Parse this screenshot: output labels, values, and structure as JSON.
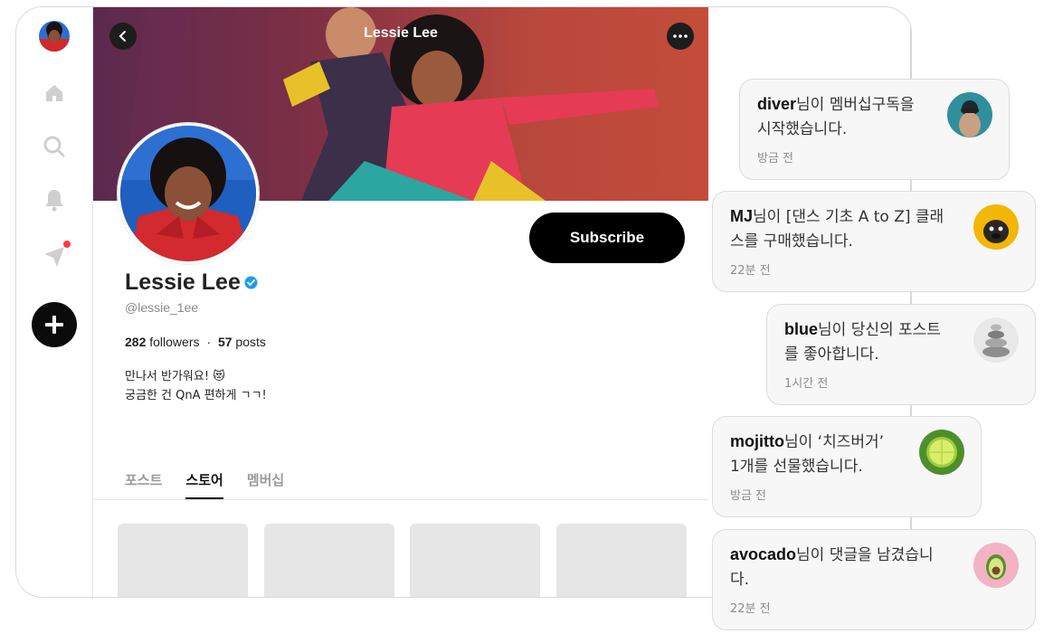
{
  "profile": {
    "cover_title": "Lessie Lee",
    "name": "Lessie Lee",
    "handle": "@lessie_1ee",
    "followers_count": "282",
    "followers_label": "followers",
    "separator": "·",
    "posts_count": "57",
    "posts_label": "posts",
    "bio_line1": "만나서 반가워요! 😻",
    "bio_line2": "궁금한 건 QnA 편하게 ㄱㄱ!",
    "subscribe_label": "Subscribe"
  },
  "tabs": [
    "포스트",
    "스토어",
    "멤버십"
  ],
  "active_tab": "스토어",
  "nav_icons": [
    "user-avatar",
    "home-icon",
    "search-icon",
    "bell-icon",
    "send-icon",
    "plus-icon"
  ],
  "notifications": [
    {
      "user": "diver",
      "text_line1": "님이 멤버십구독을",
      "text_line2": "시작했습니다.",
      "time": "방금 전",
      "avatar": "diver-avatar"
    },
    {
      "user": "MJ",
      "text_line1": "님이 [댄스 기초 A to Z] 클래",
      "text_line2": "스를 구매했습니다.",
      "time": "22분 전",
      "avatar": "dog-avatar"
    },
    {
      "user": "blue",
      "text_line1": "님이 당신의 포스트",
      "text_line2": "를 좋아합니다.",
      "time": "1시간 전",
      "avatar": "stones-avatar"
    },
    {
      "user": "mojitto",
      "text_line1": "님이 ‘치즈버거’",
      "text_line2": "1개를 선물했습니다.",
      "time": "방금 전",
      "avatar": "lime-avatar"
    },
    {
      "user": "avocado",
      "text_line1": "님이 댓글을 남겼습니",
      "text_line2": "다.",
      "time": "22분 전",
      "avatar": "avocado-avatar"
    }
  ],
  "colors": {
    "accent_black": "#000000",
    "verified_blue": "#1d9bf0",
    "notification_dot": "#ff3b47"
  }
}
